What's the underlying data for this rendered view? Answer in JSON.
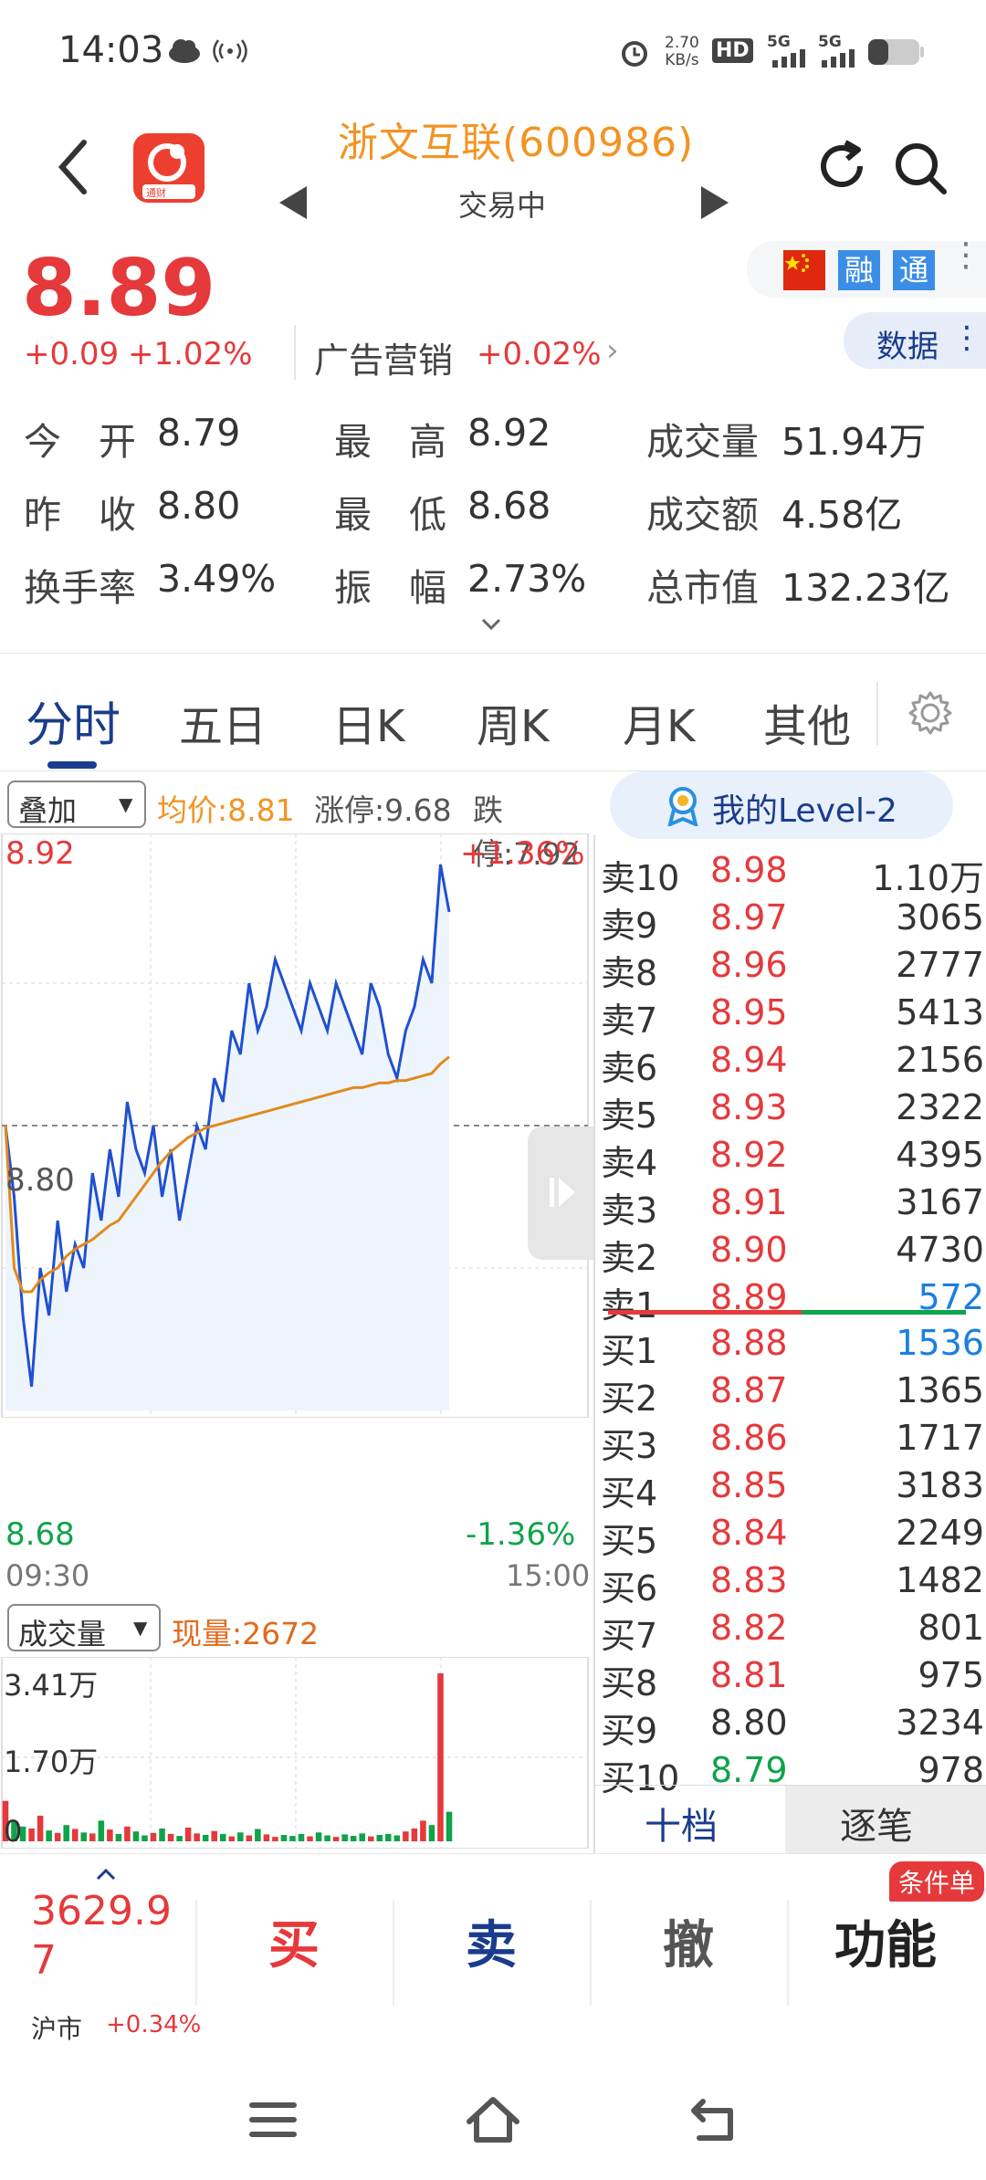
{
  "status_bar": {
    "time": "14:03",
    "net_speed_top": "2.70",
    "net_speed_bottom": "KB/s",
    "hd": "HD",
    "sig1": "5G",
    "sig2": "5G"
  },
  "header": {
    "title": "浙文互联(600986)",
    "status": "交易中",
    "logo_text": "通财"
  },
  "quote": {
    "price": "8.89",
    "change": "+0.09",
    "change_pct": "+1.02%",
    "sector_name": "广告营销",
    "sector_pct": "+0.02%",
    "badges": {
      "rong": "融",
      "tong": "通"
    },
    "data_button": "数据",
    "stats": [
      {
        "label": "今　开",
        "value": "8.79"
      },
      {
        "label": "最　高",
        "value": "8.92"
      },
      {
        "label": "成交量",
        "value": "51.94万"
      },
      {
        "label": "昨　收",
        "value": "8.80"
      },
      {
        "label": "最　低",
        "value": "8.68"
      },
      {
        "label": "成交额",
        "value": "4.58亿"
      },
      {
        "label": "换手率",
        "value": "3.49%"
      },
      {
        "label": "振　幅",
        "value": "2.73%"
      },
      {
        "label": "总市值",
        "value": "132.23亿"
      }
    ]
  },
  "tabs": [
    "分时",
    "五日",
    "日K",
    "周K",
    "月K",
    "其他"
  ],
  "chart_toolbar": {
    "overlay": "叠加",
    "avg_price": "均价:8.81",
    "limit_up": "涨停:9.68",
    "limit_down": "跌停:7.92",
    "level2": "我的Level-2"
  },
  "chart_data": {
    "type": "line",
    "x_start": "09:30",
    "x_end": "15:00",
    "y_high": "8.92",
    "y_mid": "8.80",
    "y_low": "8.68",
    "pct_high": "+1.36%",
    "pct_low": "-1.36%",
    "ylim": [
      8.68,
      8.92
    ],
    "price": [
      8.8,
      8.77,
      8.72,
      8.69,
      8.74,
      8.72,
      8.76,
      8.73,
      8.75,
      8.74,
      8.78,
      8.76,
      8.79,
      8.77,
      8.81,
      8.79,
      8.78,
      8.8,
      8.77,
      8.79,
      8.76,
      8.78,
      8.8,
      8.79,
      8.82,
      8.81,
      8.84,
      8.83,
      8.86,
      8.84,
      8.85,
      8.87,
      8.86,
      8.85,
      8.84,
      8.86,
      8.85,
      8.84,
      8.86,
      8.85,
      8.84,
      8.83,
      8.86,
      8.85,
      8.83,
      8.82,
      8.84,
      8.85,
      8.87,
      8.86,
      8.91,
      8.89
    ],
    "avg": [
      8.8,
      8.74,
      8.73,
      8.73,
      8.735,
      8.738,
      8.74,
      8.745,
      8.748,
      8.75,
      8.752,
      8.755,
      8.758,
      8.76,
      8.765,
      8.77,
      8.775,
      8.78,
      8.785,
      8.789,
      8.792,
      8.795,
      8.797,
      8.799,
      8.8,
      8.801,
      8.802,
      8.803,
      8.804,
      8.805,
      8.806,
      8.807,
      8.808,
      8.809,
      8.81,
      8.811,
      8.812,
      8.813,
      8.814,
      8.815,
      8.816,
      8.816,
      8.817,
      8.818,
      8.818,
      8.819,
      8.819,
      8.82,
      8.821,
      8.822,
      8.826,
      8.829
    ],
    "volume_label": "成交量",
    "current_volume": "现量:2672",
    "vol_max_label": "3.41万",
    "vol_mid_label": "1.70万",
    "vol_zero_label": "0",
    "vol_max": 34100,
    "volumes": [
      8200,
      4100,
      3000,
      2600,
      5200,
      2200,
      1700,
      3300,
      2500,
      1800,
      1600,
      4200,
      2400,
      1500,
      3000,
      2000,
      1200,
      1700,
      2600,
      1500,
      1100,
      2800,
      1600,
      1300,
      2100,
      1500,
      1000,
      1800,
      1200,
      2500,
      1400,
      900,
      1300,
      1100,
      1500,
      1000,
      1800,
      1200,
      900,
      1400,
      1100,
      1600,
      1000,
      1300,
      1500,
      1200,
      2000,
      2600,
      4200,
      3300,
      34100,
      6000
    ],
    "vol_up": [
      true,
      false,
      false,
      true,
      true,
      false,
      true,
      false,
      true,
      false,
      true,
      false,
      true,
      false,
      true,
      false,
      false,
      true,
      false,
      true,
      false,
      true,
      true,
      false,
      true,
      false,
      true,
      false,
      true,
      false,
      true,
      true,
      false,
      false,
      false,
      true,
      false,
      false,
      true,
      false,
      false,
      false,
      true,
      false,
      false,
      false,
      true,
      true,
      true,
      false,
      true,
      false
    ]
  },
  "order_book": {
    "asks": [
      {
        "label": "卖10",
        "price": "8.98",
        "vol": "1.10万"
      },
      {
        "label": "卖9",
        "price": "8.97",
        "vol": "3065"
      },
      {
        "label": "卖8",
        "price": "8.96",
        "vol": "2777"
      },
      {
        "label": "卖7",
        "price": "8.95",
        "vol": "5413"
      },
      {
        "label": "卖6",
        "price": "8.94",
        "vol": "2156"
      },
      {
        "label": "卖5",
        "price": "8.93",
        "vol": "2322"
      },
      {
        "label": "卖4",
        "price": "8.92",
        "vol": "4395"
      },
      {
        "label": "卖3",
        "price": "8.91",
        "vol": "3167"
      },
      {
        "label": "卖2",
        "price": "8.90",
        "vol": "4730"
      },
      {
        "label": "卖1",
        "price": "8.89",
        "vol": "572"
      }
    ],
    "bids": [
      {
        "label": "买1",
        "price": "8.88",
        "vol": "1536"
      },
      {
        "label": "买2",
        "price": "8.87",
        "vol": "1365"
      },
      {
        "label": "买3",
        "price": "8.86",
        "vol": "1717"
      },
      {
        "label": "买4",
        "price": "8.85",
        "vol": "3183"
      },
      {
        "label": "买5",
        "price": "8.84",
        "vol": "2249"
      },
      {
        "label": "买6",
        "price": "8.83",
        "vol": "1482"
      },
      {
        "label": "买7",
        "price": "8.82",
        "vol": "801"
      },
      {
        "label": "买8",
        "price": "8.81",
        "vol": "975"
      },
      {
        "label": "买9",
        "price": "8.80",
        "vol": "3234"
      },
      {
        "label": "买10",
        "price": "8.79",
        "vol": "978"
      }
    ],
    "tab_ten": "十档",
    "tab_tick": "逐笔"
  },
  "trade_bar": {
    "index_value": "3629.97",
    "index_name": "沪市",
    "index_pct": "+0.34%",
    "buy": "买",
    "sell": "卖",
    "cancel": "撤",
    "functions": "功能",
    "cond_badge": "条件单"
  },
  "colors": {
    "up": "#e5393b",
    "down": "#0fa34a",
    "line": "#2050d0",
    "avg": "#e08a1e",
    "accent_orange": "#f29423",
    "navy": "#1a3c8c"
  }
}
